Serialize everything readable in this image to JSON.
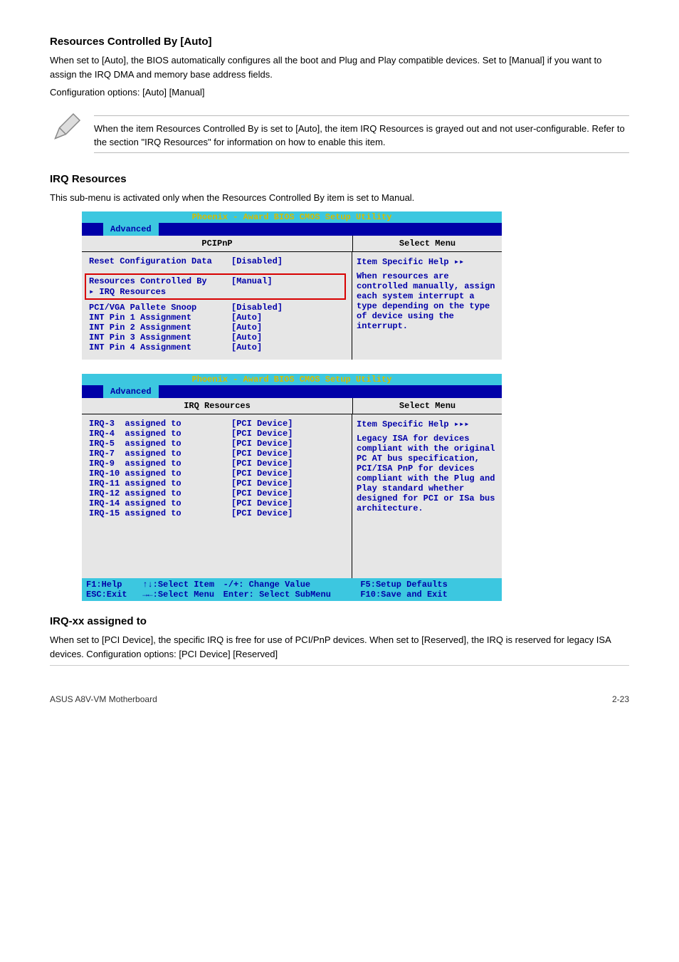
{
  "doc": {
    "section_resources_controlled": {
      "title": "Resources Controlled By [Auto]",
      "para1": "When set to [Auto], the BIOS automatically configures all the boot and Plug and Play compatible devices. Set to [Manual] if you want to assign the IRQ DMA and memory base address fields.",
      "para2": "Configuration options: [Auto] [Manual]"
    },
    "note": "When the item Resources Controlled By is set to [Auto], the item IRQ Resources is grayed out and not user-configurable. Refer to the section \"IRQ Resources\" for information on how to enable this item.",
    "section_irq": {
      "title": "IRQ Resources",
      "para1": "This sub-menu is activated only when the Resources Controlled By item is set to Manual."
    },
    "section_irq_assigned": {
      "title": "IRQ-xx assigned to",
      "para": "When set to [PCI Device], the specific IRQ is free for use of PCI/PnP devices. When set to [Reserved], the IRQ is reserved for legacy ISA devices. Configuration options: [PCI Device] [Reserved]"
    },
    "footer_left": "ASUS A8V-VM Motherboard",
    "footer_right": "2-23"
  },
  "bios1": {
    "title": "Phoenix - Award BIOS CMOS Setup Utility",
    "tab": "Advanced",
    "header_left": "PCIPnP",
    "header_right": "Select Menu",
    "help_title": "Item Specific Help ▸▸",
    "help_body": "When resources are controlled manually, assign each system interrupt a type depending on the type of device using the interrupt.",
    "settings": [
      {
        "label": "Reset Configuration Data",
        "value": "[Disabled]"
      }
    ],
    "boxed": [
      {
        "label": "Resources Controlled By",
        "value": "[Manual]"
      },
      {
        "label": "▸ IRQ Resources",
        "value": ""
      }
    ],
    "settings2": [
      {
        "label": "PCI/VGA Pallete Snoop",
        "value": "[Disabled]"
      },
      {
        "label": "INT Pin 1 Assignment",
        "value": "[Auto]"
      },
      {
        "label": "INT Pin 2 Assignment",
        "value": "[Auto]"
      },
      {
        "label": "INT Pin 3 Assignment",
        "value": "[Auto]"
      },
      {
        "label": "INT Pin 4 Assignment",
        "value": "[Auto]"
      }
    ]
  },
  "bios2": {
    "title": "Phoenix - Award BIOS CMOS Setup Utility",
    "tab": "Advanced",
    "header_left": "IRQ Resources",
    "header_right": "Select Menu",
    "help_title": "Item Specific Help ▸▸▸",
    "help_body": "Legacy ISA for devices compliant with the original PC AT bus specification, PCI/ISA PnP for devices compliant with the Plug and Play standard whether designed for PCI or ISa bus architecture.",
    "irqs": [
      {
        "label": "IRQ-3  assigned to",
        "value": "[PCI Device]"
      },
      {
        "label": "IRQ-4  assigned to",
        "value": "[PCI Device]"
      },
      {
        "label": "IRQ-5  assigned to",
        "value": "[PCI Device]"
      },
      {
        "label": "IRQ-7  assigned to",
        "value": "[PCI Device]"
      },
      {
        "label": "IRQ-9  assigned to",
        "value": "[PCI Device]"
      },
      {
        "label": "IRQ-10 assigned to",
        "value": "[PCI Device]"
      },
      {
        "label": "IRQ-11 assigned to",
        "value": "[PCI Device]"
      },
      {
        "label": "IRQ-12 assigned to",
        "value": "[PCI Device]"
      },
      {
        "label": "IRQ-14 assigned to",
        "value": "[PCI Device]"
      },
      {
        "label": "IRQ-15 assigned to",
        "value": "[PCI Device]"
      }
    ],
    "footer_keys": {
      "c1": "F1:Help    ↑↓:Select Item\nESC:Exit   →←:Select Menu",
      "c2": "-/+: Change Value\nEnter: Select SubMenu",
      "c3": "F5:Setup Defaults\nF10:Save and Exit"
    }
  }
}
